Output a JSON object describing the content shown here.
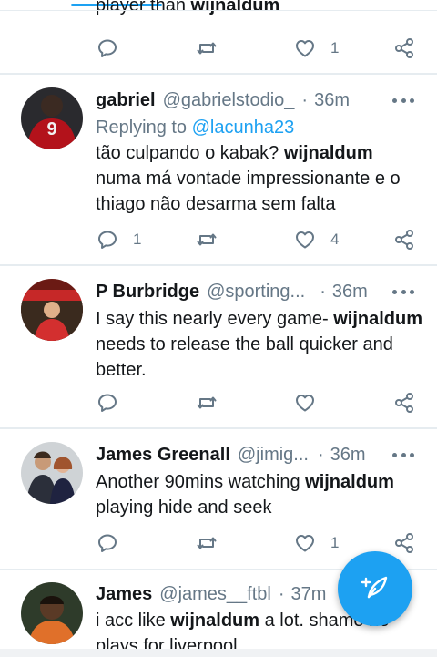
{
  "prev_tweet": {
    "text_before": "player than ",
    "text_keyword": "wijnaldum",
    "like_count": "1"
  },
  "tweets": [
    {
      "name": "gabriel",
      "handle": "@gabrielstodio_",
      "separator": "·",
      "time": "36m",
      "replying_label": "Replying to ",
      "replying_to": "@lacunha23",
      "body_before": "tão culpando o kabak? ",
      "keyword": "wijnaldum",
      "body_after": " numa má vontade impressionante e o thiago não desarma sem falta",
      "reply_count": "1",
      "retweet_count": "",
      "like_count": "4"
    },
    {
      "name": "P Burbridge",
      "handle": "@sporting...",
      "separator": "·",
      "time": "36m",
      "body_before": "I say this nearly every game- ",
      "keyword": "wijnaldum",
      "body_after": " needs to release the ball quicker and better.",
      "reply_count": "",
      "retweet_count": "",
      "like_count": ""
    },
    {
      "name": "James Greenall",
      "handle": "@jimig...",
      "separator": "·",
      "time": "36m",
      "body_before": "Another 90mins watching ",
      "keyword": "wijnaldum",
      "body_after": " playing hide and seek",
      "reply_count": "",
      "retweet_count": "",
      "like_count": "1"
    },
    {
      "name": "James",
      "handle": "@james__ftbl",
      "separator": "·",
      "time": "37m",
      "body_before": "i acc like ",
      "keyword": "wijnaldum",
      "body_after": " a lot. shame he plays for liverpool"
    }
  ],
  "icons": {
    "reply": "reply-icon",
    "retweet": "retweet-icon",
    "like": "heart-icon",
    "share": "share-icon",
    "more": "more-icon",
    "compose": "compose-tweet-icon"
  },
  "colors": {
    "accent": "#1da1f2",
    "secondary_text": "#657786",
    "primary_text": "#14171a",
    "divider": "#e6ecf0"
  }
}
